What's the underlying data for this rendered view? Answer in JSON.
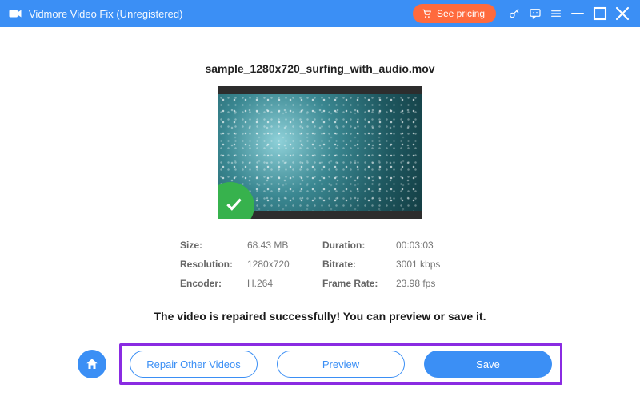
{
  "titlebar": {
    "app_title": "Vidmore Video Fix (Unregistered)",
    "pricing_label": "See pricing"
  },
  "file": {
    "name": "sample_1280x720_surfing_with_audio.mov"
  },
  "info": {
    "size_label": "Size:",
    "size_value": "68.43 MB",
    "duration_label": "Duration:",
    "duration_value": "00:03:03",
    "resolution_label": "Resolution:",
    "resolution_value": "1280x720",
    "bitrate_label": "Bitrate:",
    "bitrate_value": "3001 kbps",
    "encoder_label": "Encoder:",
    "encoder_value": "H.264",
    "framerate_label": "Frame Rate:",
    "framerate_value": "23.98 fps"
  },
  "message": {
    "success": "The video is repaired successfully! You can preview or save it."
  },
  "actions": {
    "repair_other": "Repair Other Videos",
    "preview": "Preview",
    "save": "Save"
  }
}
